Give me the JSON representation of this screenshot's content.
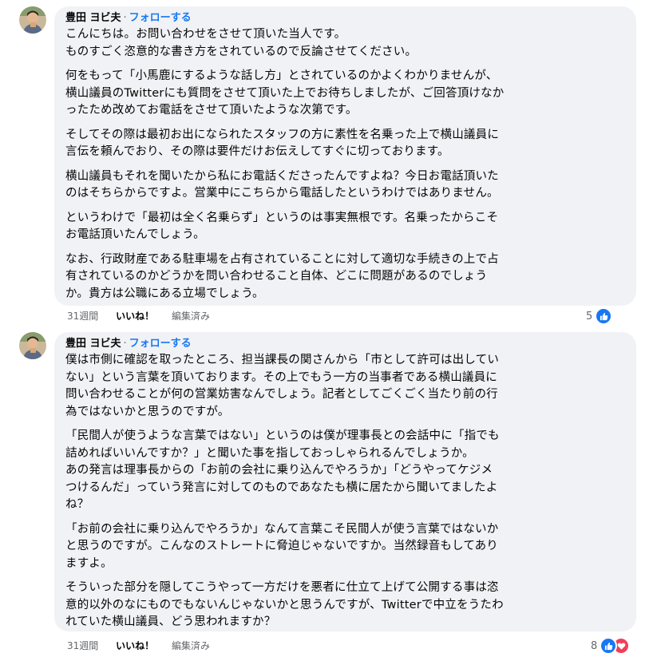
{
  "comments": [
    {
      "author": "豊田 ヨビ夫",
      "separator": "·",
      "follow_label": "フォローする",
      "paragraphs": [
        "こんにちは。お問い合わせをさせて頂いた当人です。\nものすごく恣意的な書き方をされているので反論させてください。",
        "何をもって「小馬鹿にするような話し方」とされているのかよくわかりませんが、\n横山議員のTwitterにも質問をさせて頂いた上でお待ちしましたが、ご回答頂けなか\nったため改めてお電話をさせて頂いたような次第です。",
        "そしてその際は最初お出になられたスタッフの方に素性を名乗った上で横山議員に\n言伝を頼んでおり、その際は要件だけお伝えしてすぐに切っております。",
        "横山議員もそれを聞いたから私にお電話くださったんですよね？今日お電話頂いた\nのはそちらからですよ。営業中にこちらから電話したというわけではありません。",
        "というわけで「最初は全く名乗らず」というのは事実無根です。名乗ったからこそ\nお電話頂いたんでしょう。",
        "なお、行政財産である駐車場を占有されていることに対して適切な手続きの上で占\n有されているのかどうかを問い合わせること自体、どこに問題があるのでしょう\nか。貴方は公職にある立場でしょう。"
      ],
      "time": "31週間",
      "like_label": "いいね！",
      "edited_label": "編集済み",
      "reaction_count": "5",
      "reactions": [
        "like"
      ]
    },
    {
      "author": "豊田 ヨビ夫",
      "separator": "·",
      "follow_label": "フォローする",
      "paragraphs": [
        "僕は市側に確認を取ったところ、担当課長の関さんから「市として許可は出してい\nない」という言葉を頂いております。その上でもう一方の当事者である横山議員に\n問い合わせることが何の営業妨害なんでしょう。記者としてごくごく当たり前の行\n為ではないかと思うのですが。",
        "「民間人が使うような言葉ではない」というのは僕が理事長との会話中に「指でも\n詰めればいいんですか？」と聞いた事を指しておっしゃられるんでしょうか。\nあの発言は理事長からの「お前の会社に乗り込んでやろうか」「どうやってケジメ\nつけるんだ」っていう発言に対してのものであなたも横に居たから聞いてましたよ\nね？",
        "「お前の会社に乗り込んでやろうか」なんて言葉こそ民間人が使う言葉ではないか\nと思うのですが。こんなのストレートに脅迫じゃないですか。当然録音もしてあり\nますよ。",
        "そういった部分を隠してこうやって一方だけを悪者に仕立て上げて公開する事は恣\n意的以外のなにものでもないんじゃないかと思うんですが、Twitterで中立をうたわ\nれていた横山議員、どう思われますか？"
      ],
      "time": "31週間",
      "like_label": "いいね！",
      "edited_label": "編集済み",
      "reaction_count": "8",
      "reactions": [
        "like",
        "love"
      ]
    }
  ],
  "colors": {
    "bubble": "#f0f2f5",
    "follow_link": "#1877f2",
    "meta_text": "#65676b",
    "like_reaction": "#1877f2",
    "love_reaction": "#f33e58"
  }
}
